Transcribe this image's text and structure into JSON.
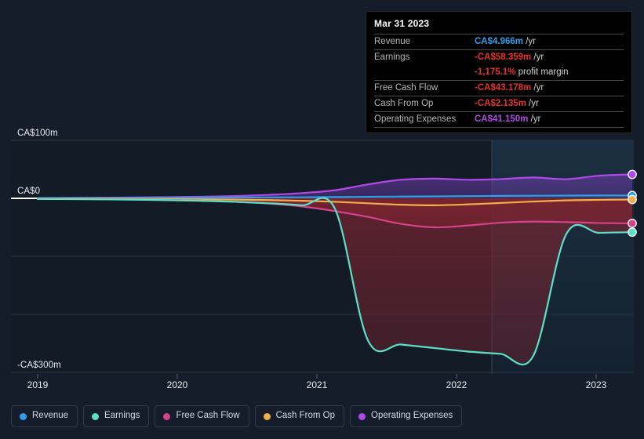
{
  "chart_data": {
    "type": "area",
    "title": "",
    "xlabel": "",
    "ylabel": "",
    "currency": "CA$",
    "grid": true,
    "legend_position": "bottom-left",
    "ylim": [
      -300,
      100
    ],
    "y_ticks": [
      {
        "value": 100,
        "label": "CA$100m"
      },
      {
        "value": 0,
        "label": "CA$0"
      },
      {
        "value": -300,
        "label": "-CA$300m"
      }
    ],
    "y_gridlines": [
      100,
      0,
      -100,
      -200,
      -300
    ],
    "x_ticks": [
      "2019",
      "2020",
      "2021",
      "2022",
      "2023"
    ],
    "xlim": [
      "2018-09",
      "2023-06"
    ],
    "forecast_divider_x": "2022-01",
    "series": [
      {
        "name": "Revenue",
        "color": "#2e9fe8",
        "values": [
          0.4,
          0.5,
          0.6,
          0.8,
          1.0,
          1.2,
          1.4,
          1.6,
          1.8,
          2.2,
          2.6,
          3.0,
          3.4,
          3.8,
          4.2,
          4.5,
          4.7,
          4.9,
          4.966
        ]
      },
      {
        "name": "Earnings",
        "color": "#5ce0c8",
        "values": [
          -1.0,
          -1.4,
          -1.8,
          -2.4,
          -3.2,
          -4.4,
          -6.0,
          -8.5,
          -12.0,
          -18.0,
          -245.0,
          -252.0,
          -258.0,
          -264.0,
          -268.0,
          -272.0,
          -62.0,
          -59.5,
          -58.359
        ]
      },
      {
        "name": "Free Cash Flow",
        "color": "#d6438a",
        "values": [
          -0.8,
          -1.1,
          -1.5,
          -2.0,
          -2.8,
          -4.0,
          -6.0,
          -9.0,
          -14.0,
          -22.0,
          -32.0,
          -44.0,
          -50.0,
          -47.0,
          -42.0,
          -40.0,
          -41.0,
          -42.5,
          -43.178
        ]
      },
      {
        "name": "Cash From Op",
        "color": "#eeb14a",
        "values": [
          -0.4,
          -0.5,
          -0.7,
          -0.9,
          -1.2,
          -1.6,
          -2.2,
          -3.0,
          -4.2,
          -6.0,
          -8.5,
          -11.0,
          -12.0,
          -10.5,
          -8.0,
          -5.5,
          -3.5,
          -2.6,
          -2.135
        ]
      },
      {
        "name": "Operating Expenses",
        "color": "#b049e8",
        "values": [
          0.6,
          0.8,
          1.1,
          1.5,
          2.0,
          2.8,
          4.0,
          6.0,
          9.0,
          14.0,
          24.0,
          32.0,
          34.0,
          32.0,
          33.0,
          36.0,
          33.0,
          39.0,
          41.15
        ]
      }
    ]
  },
  "tooltip": {
    "title": "Mar 31 2023",
    "unit": "/yr",
    "rows": [
      {
        "key": "Revenue",
        "value": "CA$4.966m",
        "color": "#2e9fe8",
        "unit": "/yr"
      },
      {
        "key": "Earnings",
        "value": "-CA$58.359m",
        "color": "#e8312b",
        "unit": "/yr"
      },
      {
        "key": "",
        "value": "-1,175.1%",
        "color": "#e8312b",
        "unit": "profit margin"
      },
      {
        "key": "Free Cash Flow",
        "value": "-CA$43.178m",
        "color": "#e8312b",
        "unit": "/yr"
      },
      {
        "key": "Cash From Op",
        "value": "-CA$2.135m",
        "color": "#e8312b",
        "unit": "/yr"
      },
      {
        "key": "Operating Expenses",
        "value": "CA$41.150m",
        "color": "#b049e8",
        "unit": "/yr"
      }
    ]
  },
  "legend": {
    "items": [
      {
        "label": "Revenue",
        "color": "#2e9fe8"
      },
      {
        "label": "Earnings",
        "color": "#5ce0c8"
      },
      {
        "label": "Free Cash Flow",
        "color": "#d6438a"
      },
      {
        "label": "Cash From Op",
        "color": "#eeb14a"
      },
      {
        "label": "Operating Expenses",
        "color": "#b049e8"
      }
    ]
  }
}
